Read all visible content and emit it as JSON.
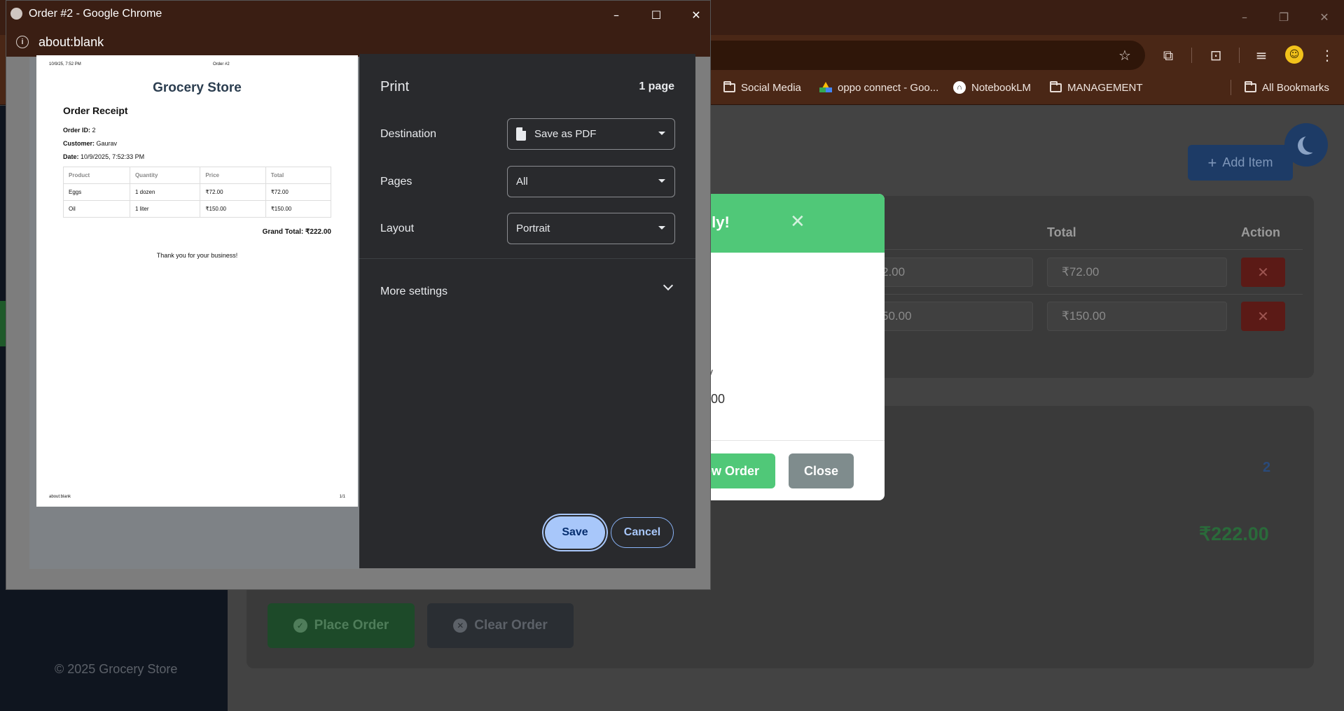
{
  "bookmarks": [
    {
      "label": "Social Media",
      "icon": "folder-icon"
    },
    {
      "label": "oppo connect - Goo...",
      "icon": "google-drive-icon"
    },
    {
      "label": "NotebookLM",
      "icon": "notebooklm-icon"
    },
    {
      "label": "MANAGEMENT",
      "icon": "folder-icon"
    }
  ],
  "all_bookmarks": "All Bookmarks",
  "app": {
    "add_item": "Add Item",
    "columns": {
      "total": "Total",
      "action": "Action"
    },
    "rows": [
      {
        "price_partial": "2.00",
        "total": "₹72.00"
      },
      {
        "price_partial": "50.00",
        "total": "₹150.00"
      }
    ],
    "items_count": "2",
    "grand_total": "₹222.00",
    "place_order": "Place Order",
    "clear_order": "Clear Order",
    "footer": "© 2025 Grocery Store"
  },
  "modal": {
    "title_partial": "lly!",
    "line1_partial": "v",
    "line2_partial": ".00",
    "new_order_partial": "ew Order",
    "close": "Close"
  },
  "print_window": {
    "title": "Order #2 - Google Chrome",
    "url": "about:blank"
  },
  "preview": {
    "header_left": "10/9/25, 7:52 PM",
    "header_center": "Order #2",
    "store": "Grocery Store",
    "receipt_title": "Order Receipt",
    "order_id_label": "Order ID:",
    "order_id": "2",
    "customer_label": "Customer:",
    "customer": "Gaurav",
    "date_label": "Date:",
    "date": "10/9/2025, 7:52:33 PM",
    "table_headers": [
      "Product",
      "Quantity",
      "Price",
      "Total"
    ],
    "table_rows": [
      [
        "Eggs",
        "1 dozen",
        "₹72.00",
        "₹72.00"
      ],
      [
        "Oil",
        "1 liter",
        "₹150.00",
        "₹150.00"
      ]
    ],
    "grand_total": "Grand Total: ₹222.00",
    "thanks": "Thank you for your business!",
    "footer_left": "about:blank",
    "footer_right": "1/1"
  },
  "print_settings": {
    "title": "Print",
    "page_count": "1 page",
    "destination_label": "Destination",
    "destination_value": "Save as PDF",
    "pages_label": "Pages",
    "pages_value": "All",
    "layout_label": "Layout",
    "layout_value": "Portrait",
    "more_settings": "More settings",
    "save": "Save",
    "cancel": "Cancel"
  }
}
